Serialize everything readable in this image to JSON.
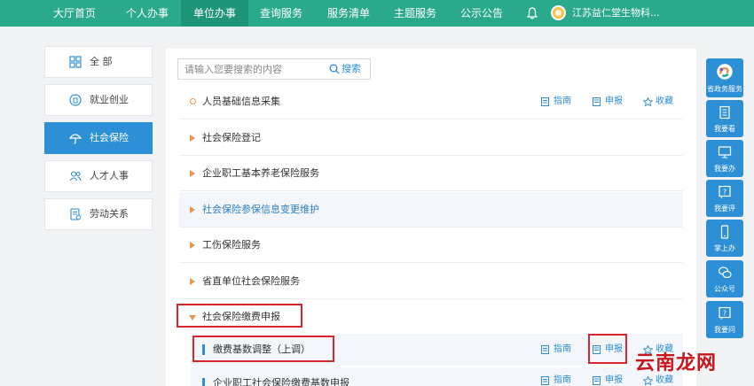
{
  "nav": {
    "items": [
      "大厅首页",
      "个人办事",
      "单位办事",
      "查询服务",
      "服务清单",
      "主题服务",
      "公示公告"
    ],
    "user": "江苏益仁堂生物科..."
  },
  "categories": [
    {
      "label": "全 部",
      "icon": "grid-icon"
    },
    {
      "label": "就业创业",
      "icon": "briefcase-icon"
    },
    {
      "label": "社会保险",
      "icon": "umbrella-icon"
    },
    {
      "label": "人才人事",
      "icon": "people-icon"
    },
    {
      "label": "劳动关系",
      "icon": "document-icon"
    }
  ],
  "search": {
    "placeholder": "请输入您要搜索的内容",
    "button": "搜索"
  },
  "services": [
    "人员基础信息采集",
    "社会保险登记",
    "企业职工基本养老保险服务",
    "社会保险参保信息变更维护",
    "工伤保险服务",
    "省直单位社会保险服务",
    "社会保险缴费申报"
  ],
  "sub_services": [
    "缴费基数调整（上调）",
    "企业职工社会保险缴费基数申报"
  ],
  "actions": {
    "guide": "指南",
    "apply": "申报",
    "favorite": "收藏"
  },
  "side": [
    "省政务服务",
    "我要看",
    "我要办",
    "我要评",
    "掌上办",
    "公众号",
    "我要问"
  ],
  "watermark": "云南龙网",
  "colors": {
    "nav": "#2aaa8a",
    "accent": "#2d8fd5",
    "marker": "#e8944a",
    "highlight_box": "#d9262c"
  }
}
